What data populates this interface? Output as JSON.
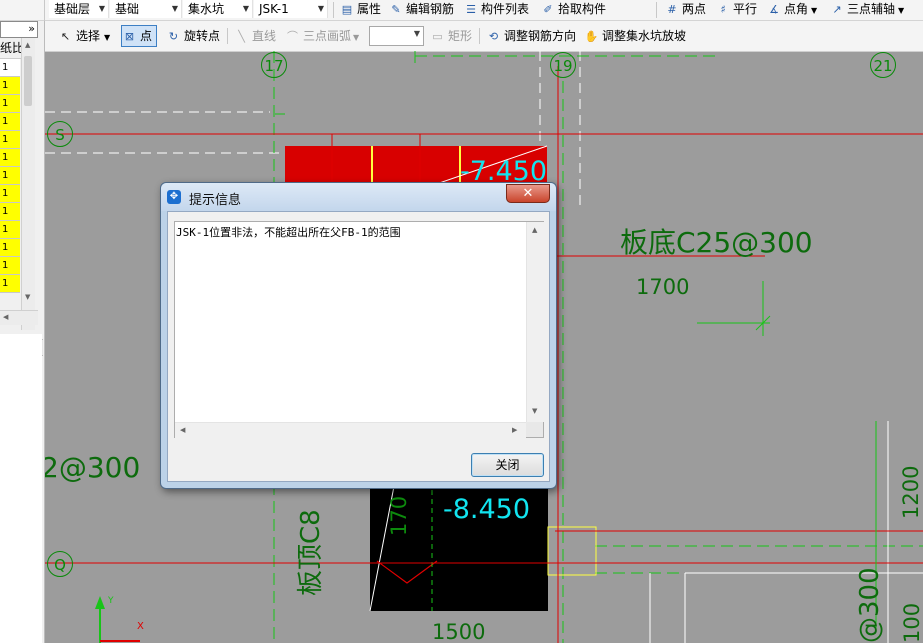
{
  "toolbar_top": {
    "floor": "基础层",
    "category": "基础",
    "component_type": "集水坑",
    "component": "JSK-1",
    "buttons": [
      {
        "label": "属性",
        "icon": "properties-icon"
      },
      {
        "label": "编辑钢筋",
        "icon": "edit-rebar-icon"
      },
      {
        "label": "构件列表",
        "icon": "component-list-icon"
      },
      {
        "label": "拾取构件",
        "icon": "pick-component-icon"
      },
      {
        "label": "两点",
        "icon": "two-point-axis-icon"
      },
      {
        "label": "平行",
        "icon": "parallel-axis-icon"
      },
      {
        "label": "点角",
        "icon": "point-angle-axis-icon"
      },
      {
        "label": "三点辅轴",
        "icon": "three-point-axis-icon"
      }
    ]
  },
  "toolbar_draw": {
    "select": "选择",
    "point": "点",
    "rotate_point": "旋转点",
    "line": "直线",
    "arc": "三点画弧",
    "rect": "矩形",
    "adjust_rebar": "调整钢筋方向",
    "adjust_slope": "调整集水坑放坡"
  },
  "left_panel": {
    "header": "纸比",
    "rows": [
      "1",
      "1",
      "1",
      "1",
      "1",
      "1",
      "1",
      "1",
      "1",
      "1",
      "1",
      "1",
      "1"
    ],
    "pin": "ǂ",
    "close": "×"
  },
  "cad": {
    "axes": [
      "17",
      "19",
      "21",
      "S",
      "Q"
    ],
    "elev_top": "-7.450",
    "elev_bottom": "-8.450",
    "label_board_bottom": "板底C25@300",
    "dim_1700": "1700",
    "label_left": "2@300",
    "label_vertical_top": "板顶C8",
    "dim_vertical_170": "170",
    "dim_1500": "1500",
    "dim_1200": "1200",
    "label_right_300": "@300",
    "dim_1001": "100",
    "axis_x": "X",
    "axis_y": "Y"
  },
  "dialog": {
    "title": "提示信息",
    "message": "JSK-1位置非法，不能超出所在父FB-1的范围",
    "close_button": "关闭",
    "close_x": "✕"
  },
  "colors": {
    "cad_bg": "#9c9c9c",
    "axis_green": "#0a8a0a",
    "red_line": "#e00000",
    "elev_cyan": "#12e5f0",
    "hatch_red": "#d80000"
  }
}
